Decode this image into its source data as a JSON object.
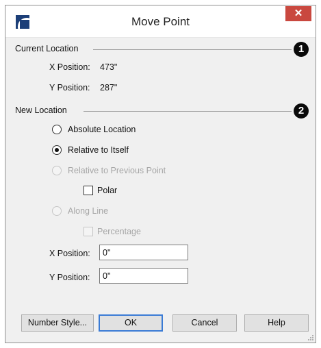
{
  "window": {
    "title": "Move Point",
    "close_glyph": "✕"
  },
  "current_location": {
    "heading": "Current Location",
    "marker": "1",
    "x_label": "X Position:",
    "x_value": "473\"",
    "y_label": "Y Position:",
    "y_value": "287\""
  },
  "new_location": {
    "heading": "New Location",
    "marker": "2",
    "options": [
      {
        "label": "Absolute Location",
        "selected": false,
        "enabled": true
      },
      {
        "label": "Relative to Itself",
        "selected": true,
        "enabled": true
      },
      {
        "label": "Relative to Previous Point",
        "selected": false,
        "enabled": false
      },
      {
        "label": "Along Line",
        "selected": false,
        "enabled": false
      }
    ],
    "polar_label": "Polar",
    "percentage_label": "Percentage",
    "x_label": "X Position:",
    "x_value": "0\"",
    "y_label": "Y Position:",
    "y_value": "0\""
  },
  "buttons": {
    "number_style": "Number Style...",
    "ok": "OK",
    "cancel": "Cancel",
    "help": "Help"
  }
}
